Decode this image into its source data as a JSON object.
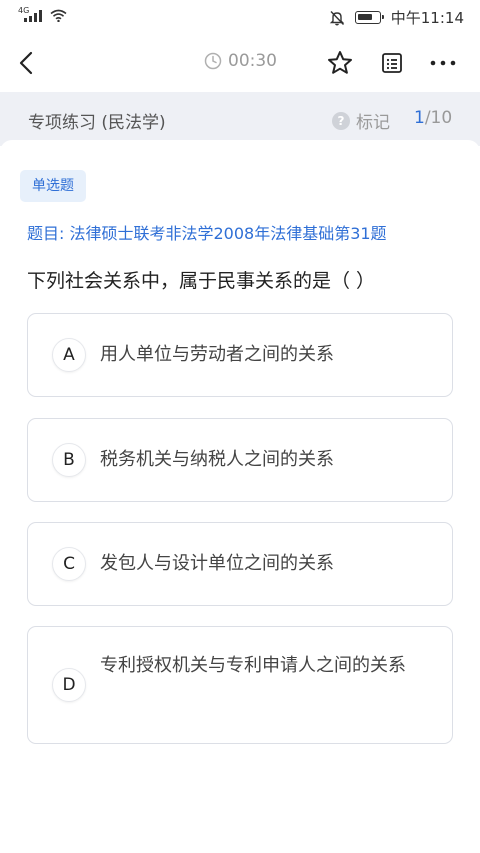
{
  "status_bar": {
    "network": "4G",
    "time": "中午11:14",
    "icons": [
      "signal-icon",
      "wifi-icon",
      "mute-icon",
      "battery-icon"
    ]
  },
  "nav": {
    "timer": "00:30",
    "icons": [
      "back-arrow-icon",
      "clock-icon",
      "star-icon",
      "answer-sheet-icon",
      "more-icon"
    ]
  },
  "sub_header": {
    "title": "专项练习 (民法学)",
    "mark_label": "标记",
    "help_glyph": "?",
    "progress_current": "1",
    "progress_total": "/10"
  },
  "question": {
    "type": "单选题",
    "source": "题目: 法律硕士联考非法学2008年法律基础第31题",
    "stem": "下列社会关系中，属于民事关系的是（ ）",
    "options": [
      {
        "letter": "A",
        "text": "用人单位与劳动者之间的关系"
      },
      {
        "letter": "B",
        "text": "税务机关与纳税人之间的关系"
      },
      {
        "letter": "C",
        "text": "发包人与设计单位之间的关系"
      },
      {
        "letter": "D",
        "text": "专利授权机关与专利申请人之间的关系"
      }
    ]
  },
  "colors": {
    "accent": "#2f6fd6",
    "sub_header_bg": "#eef0f5",
    "badge_bg": "#e7f0fb",
    "border": "#dcdfe6"
  }
}
